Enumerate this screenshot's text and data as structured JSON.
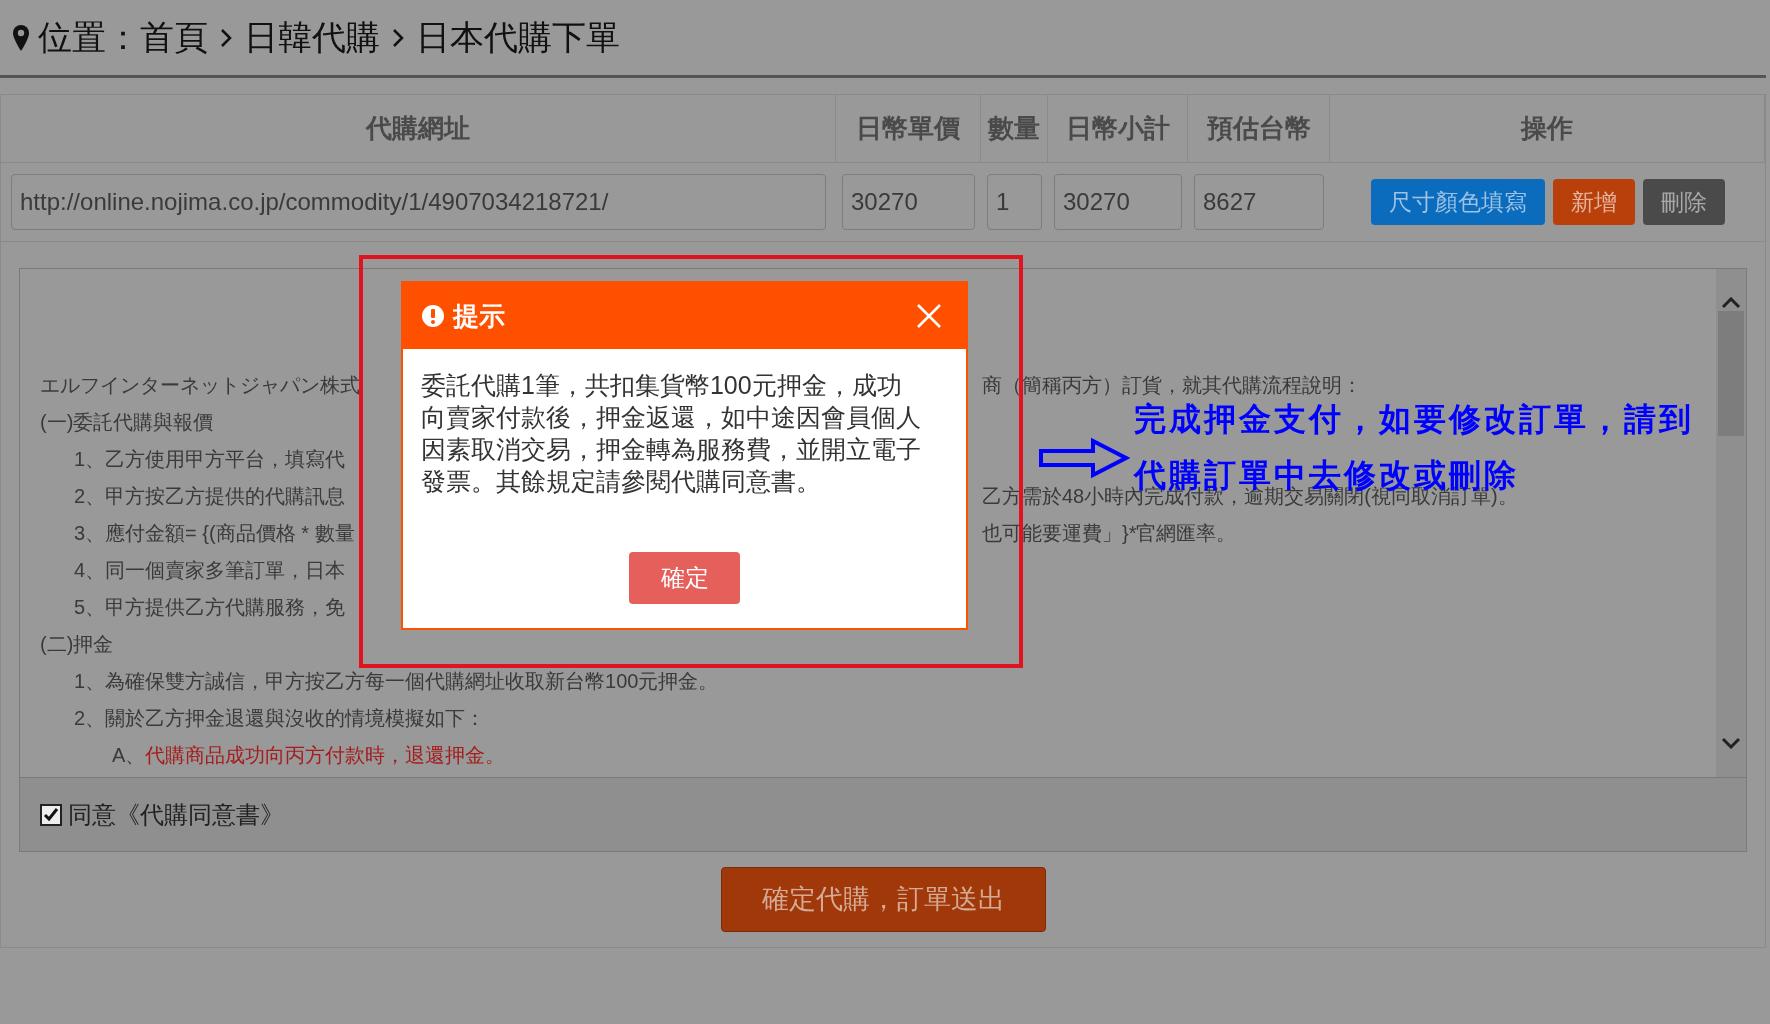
{
  "breadcrumb": {
    "label": "位置：",
    "items": [
      "首頁",
      "日韓代購",
      "日本代購下單"
    ]
  },
  "table": {
    "columns": [
      "代購網址",
      "日幣單價",
      "數量",
      "日幣小計",
      "預估台幣",
      "操作"
    ],
    "row": {
      "url": "http://online.nojima.co.jp/commodity/1/4907034218721/",
      "unit_price": "30270",
      "quantity": "1",
      "subtotal": "30270",
      "estimate": "8627"
    },
    "actions": [
      {
        "label": "尺寸顏色填寫",
        "kind": "primary"
      },
      {
        "label": "新增",
        "kind": "add"
      },
      {
        "label": "刪除",
        "kind": "delete"
      }
    ]
  },
  "terms": {
    "intro": {
      "left": "エルフインターネットジャパン株式",
      "right": "商（簡稱丙方）訂貨，就其代購流程說明："
    },
    "sections": [
      {
        "heading": "(一)委託代購與報價",
        "items": [
          {
            "left": "1、乙方使用甲方平台，填寫代"
          },
          {
            "left": "2、甲方按乙方提供的代購訊息",
            "right": "乙方需於48小時內完成付款，逾期交易關閉(視同取消訂單)。"
          },
          {
            "left": "3、應付金額= {(商品價格 * 數量",
            "right": "也可能要運費」}*官網匯率。"
          },
          {
            "left": "4、同一個賣家多筆訂單，日本"
          },
          {
            "left": "5、甲方提供乙方代購服務，免"
          }
        ]
      },
      {
        "heading": "(二)押金",
        "items": [
          {
            "left": "1、為確保雙方誠信，甲方按乙方每一個代購網址收取新台幣100元押金。"
          },
          {
            "left": "2、關於乙方押金退還與沒收的情境模擬如下：",
            "children": [
              {
                "marker": "A、",
                "text": "代購商品成功向丙方付款時，退還押金。",
                "color": "#a51c1c"
              }
            ]
          }
        ]
      }
    ]
  },
  "agreement": {
    "label": "同意《代購同意書》",
    "checked": true
  },
  "submit": "確定代購，訂單送出",
  "dialog": {
    "title": "提示",
    "message": "委託代購1筆，共扣集貨幣100元押金，成功向賣家付款後，押金返還，如中途因會員個人因素取消交易，押金轉為服務費，並開立電子發票。其餘規定請參閱代購同意書。",
    "confirm": "確定"
  },
  "annotation": {
    "lines": [
      "完成押金支付，如要修改訂單，請到",
      "代購訂單中去修改或刪除"
    ]
  }
}
